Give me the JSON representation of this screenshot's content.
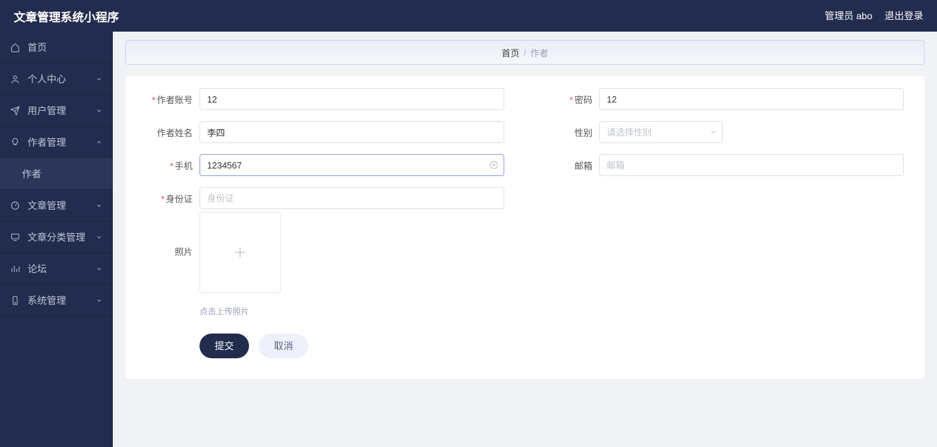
{
  "app": {
    "title": "文章管理系统小程序"
  },
  "header": {
    "user": "管理员 abo",
    "logout": "退出登录"
  },
  "sidebar": {
    "items": [
      {
        "label": "首页",
        "icon": "home-icon",
        "expandable": false
      },
      {
        "label": "个人中心",
        "icon": "user-icon",
        "expandable": true,
        "open": false
      },
      {
        "label": "用户管理",
        "icon": "paperplane-icon",
        "expandable": true,
        "open": false
      },
      {
        "label": "作者管理",
        "icon": "lightbulb-icon",
        "expandable": true,
        "open": true
      },
      {
        "label": "作者",
        "sub": true
      },
      {
        "label": "文章管理",
        "icon": "gauge-icon",
        "expandable": true,
        "open": false
      },
      {
        "label": "文章分类管理",
        "icon": "monitor-icon",
        "expandable": true,
        "open": false
      },
      {
        "label": "论坛",
        "icon": "barchart-icon",
        "expandable": true,
        "open": false
      },
      {
        "label": "系统管理",
        "icon": "phone-icon",
        "expandable": true,
        "open": false
      }
    ]
  },
  "breadcrumb": {
    "root": "首页",
    "current": "作者"
  },
  "form": {
    "account": {
      "label": "作者账号",
      "value": "12",
      "required": true
    },
    "password": {
      "label": "密码",
      "value": "12",
      "required": true
    },
    "name": {
      "label": "作者姓名",
      "value": "李四",
      "required": false
    },
    "gender": {
      "label": "性别",
      "placeholder": "请选择性别",
      "required": false
    },
    "phone": {
      "label": "手机",
      "value": "1234567",
      "required": true
    },
    "email": {
      "label": "邮箱",
      "placeholder": "邮箱",
      "value": "",
      "required": false
    },
    "idcard": {
      "label": "身份证",
      "placeholder": "身份证",
      "value": "",
      "required": true
    },
    "photo": {
      "label": "照片",
      "hint": "点击上传照片"
    },
    "submit": "提交",
    "cancel": "取消"
  }
}
